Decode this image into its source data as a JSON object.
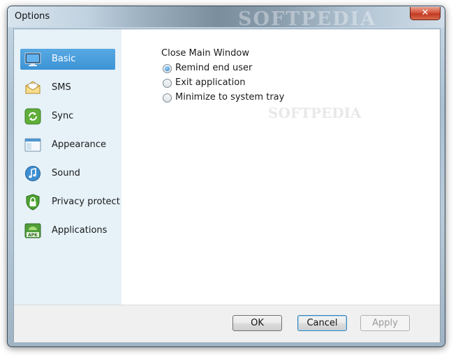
{
  "window": {
    "title": "Options",
    "watermark": "SOFTPEDIA",
    "close_glyph": "✕"
  },
  "sidebar": {
    "items": [
      {
        "label": "Basic",
        "icon": "monitor-icon",
        "selected": true
      },
      {
        "label": "SMS",
        "icon": "envelope-icon",
        "selected": false
      },
      {
        "label": "Sync",
        "icon": "sync-icon",
        "selected": false
      },
      {
        "label": "Appearance",
        "icon": "window-icon",
        "selected": false
      },
      {
        "label": "Sound",
        "icon": "music-note-icon",
        "selected": false
      },
      {
        "label": "Privacy protect",
        "icon": "lock-shield-icon",
        "selected": false
      },
      {
        "label": "Applications",
        "icon": "apk-icon",
        "selected": false
      }
    ]
  },
  "main": {
    "group_title": "Close Main Window",
    "options": [
      {
        "label": "Remind end user",
        "checked": true
      },
      {
        "label": "Exit application",
        "checked": false
      },
      {
        "label": "Minimize to system tray",
        "checked": false
      }
    ]
  },
  "footer": {
    "ok_label": "OK",
    "cancel_label": "Cancel",
    "apply_label": "Apply",
    "apply_enabled": false
  },
  "colors": {
    "selected_item_bg": "#4a9edc",
    "sidebar_bg": "#e6f1f8",
    "close_button": "#c13a22"
  }
}
